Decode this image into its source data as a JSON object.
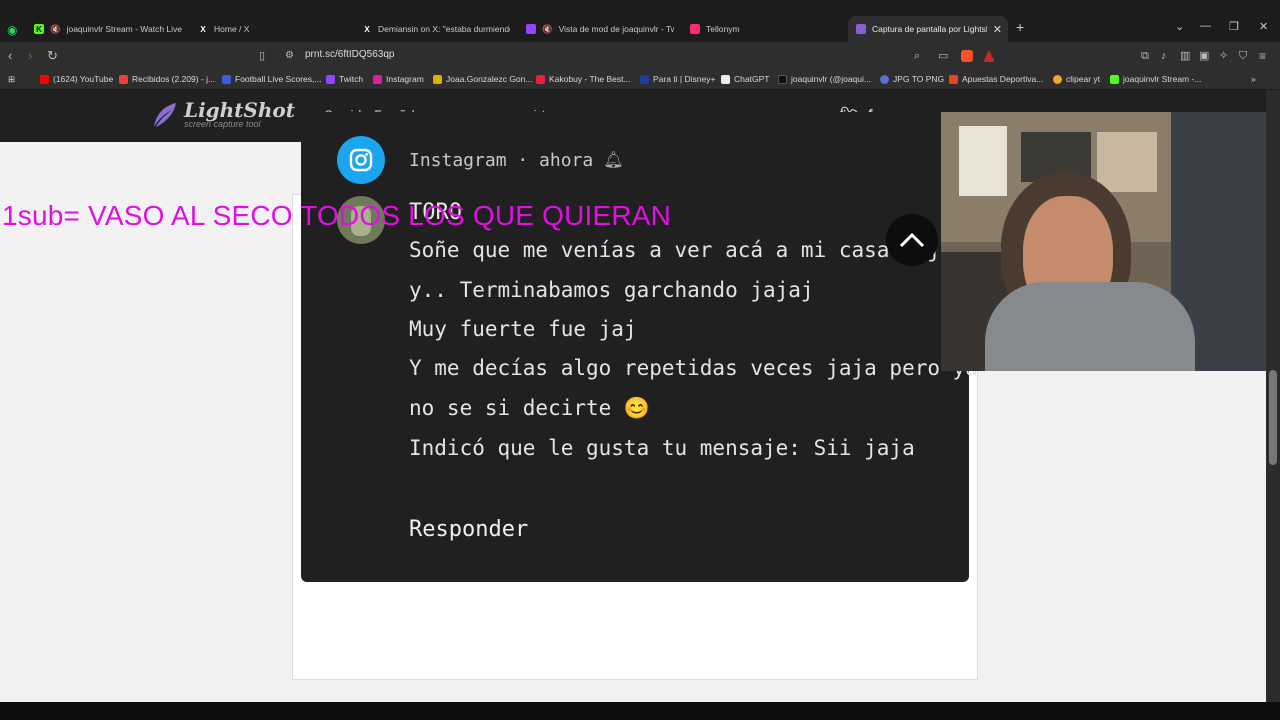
{
  "browser": {
    "tabs": [
      {
        "label": "joaquinvlr Stream - Watch Live on Kick",
        "active": false
      },
      {
        "label": "Home / X",
        "active": false
      },
      {
        "label": "Demiansin on X: \"estaba durmiendo",
        "active": false
      },
      {
        "label": "Vista de mod de joaquinvlr - Twitch",
        "active": false
      },
      {
        "label": "Tellonym",
        "active": false
      },
      {
        "label": "Captura de pantalla por Lightshot",
        "active": true
      }
    ],
    "url": "prnt.sc/6ftIDQ563qp",
    "bookmarks": [
      "(1624) YouTube",
      "Recibidos (2.209) - j...",
      "Football Live Scores,...",
      "Twitch",
      "Instagram",
      "Joaa.Gonzalezc Gon...",
      "Kakobuy - The Best...",
      "Para ti | Disney+",
      "ChatGPT",
      "joaquinvlr (@joaqui...",
      "JPG TO PNG",
      "Apuestas Deportiva...",
      "clipear yt",
      "joaquinvlr Stream -..."
    ]
  },
  "lightshot": {
    "logo_name": "LightShot",
    "logo_tagline": "screen capture tool",
    "language": "Spanish - Español",
    "register": "registrarse"
  },
  "overlay": {
    "text": "1sub= VASO AL SECO TODOS LOS QUE QUIERAN"
  },
  "screenshot": {
    "source": "Instagram · ahora",
    "sender": "TORO",
    "lines": [
      "Soñe que me venías a ver acá a mi casa jaja",
      "y.. Terminabamos garchando jajaj",
      "Muy fuerte fue jaj",
      "Y me decías algo repetidas veces jaja pero ya",
      "no se si decirte 😊",
      "Indicó que le gusta tu mensaje: Sii jaja"
    ],
    "reply": "Responder"
  },
  "colors": {
    "overlay": "#e10fe0",
    "instagram_blue": "#1ba5ee",
    "screenshot_bg": "#202020",
    "header_bg": "#202020"
  }
}
